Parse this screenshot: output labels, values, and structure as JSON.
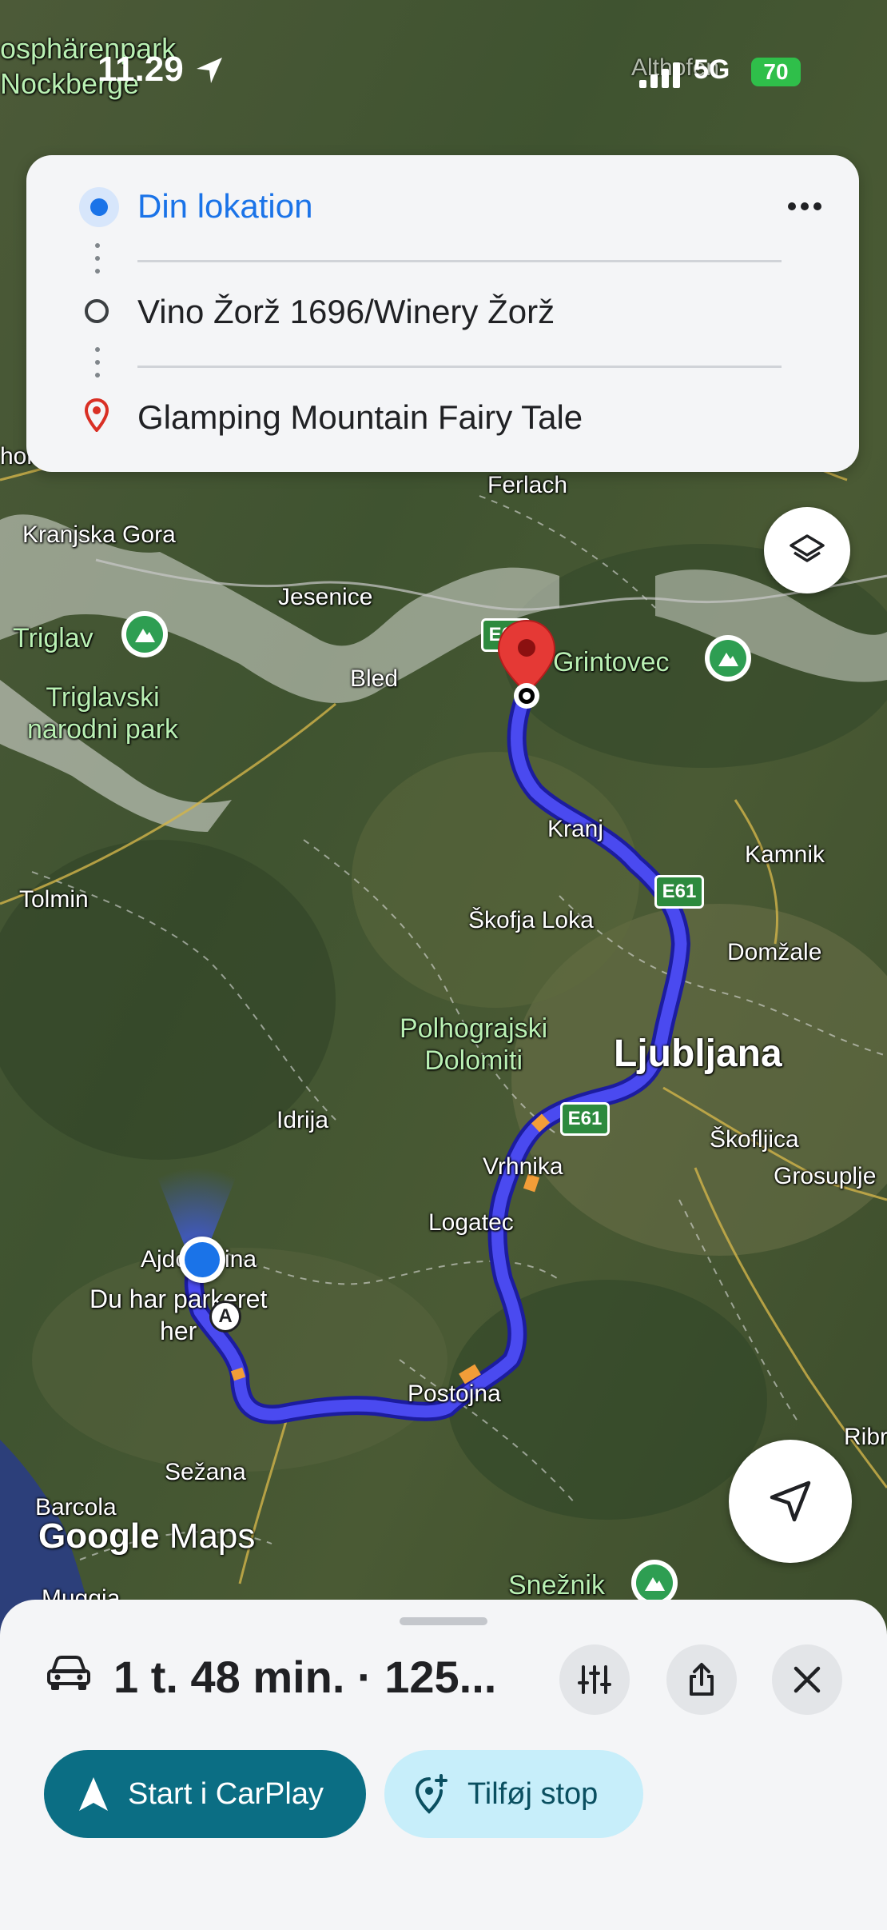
{
  "status_bar": {
    "time": "11.29",
    "network": "5G",
    "battery": "70"
  },
  "directions": {
    "origin": "Din lokation",
    "waypoint": "Vino Žorž 1696/Winery Žorž",
    "destination": "Glamping Mountain Fairy Tale"
  },
  "map": {
    "top_labels": [
      "osphärenpark",
      "Nockberge",
      "Althofen"
    ],
    "places": {
      "ferlach": "Ferlach",
      "kranjska_gora": "Kranjska Gora",
      "jesenice": "Jesenice",
      "bled": "Bled",
      "kranj": "Kranj",
      "kamnik": "Kamnik",
      "tolmin": "Tolmin",
      "skofja_loka": "Škofja Loka",
      "domzale": "Domžale",
      "ljubljana": "Ljubljana",
      "skofljica": "Škofljica",
      "grosuplje": "Grosuplje",
      "idrija": "Idrija",
      "vrhnika": "Vrhnika",
      "logatec": "Logatec",
      "ajdovscina": "Ajdovščina",
      "postojna": "Postojna",
      "sezana": "Sežana",
      "barcola": "Barcola",
      "ribnica": "Ribr",
      "muggia": "Muggia",
      "hol": "holo"
    },
    "green_places": {
      "triglav": "Triglav",
      "triglavski": "Triglavski\nnarodni park",
      "grintovec": "Grintovec",
      "polhograjski": "Polhograjski\nDolomiti",
      "sneznik": "Snežnik"
    },
    "road_shields": [
      "E61",
      "E61",
      "E61"
    ],
    "parked_note": "Du har parkeret\nher",
    "waypoint_marker": "A",
    "attribution": {
      "google": "Google",
      "maps": "Maps"
    },
    "colors": {
      "route": "#4a4af0",
      "route_outline": "#1c1c9e",
      "traffic": "#f29d38",
      "pin": "#e53935",
      "location": "#1a73e8"
    }
  },
  "sheet": {
    "summary": "1 t. 48 min. · 125...",
    "start_button": "Start i CarPlay",
    "add_stop_button": "Tilføj stop",
    "icons": [
      "car-icon",
      "options-icon",
      "share-icon",
      "close-icon",
      "navigation-arrow-icon",
      "add-location-icon"
    ]
  }
}
